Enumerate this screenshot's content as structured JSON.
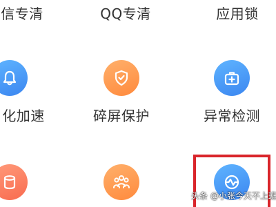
{
  "features": {
    "row1": [
      {
        "label": "信专清"
      },
      {
        "label": "QQ专清"
      },
      {
        "label": "应用锁"
      }
    ],
    "row2": [
      {
        "label": "化加速",
        "icon": "bell-icon"
      },
      {
        "label": "碎屏保护",
        "icon": "shield-check-icon"
      },
      {
        "label": "异常检测",
        "icon": "medical-kit-icon"
      }
    ],
    "row3": [
      {
        "icon": "cylinder-icon"
      },
      {
        "icon": "family-icon"
      },
      {
        "icon": "heartbeat-icon"
      }
    ]
  },
  "watermark": {
    "text": "头条 @小张今天不上班啦"
  },
  "colors": {
    "blue": "#3b86f0",
    "orange": "#ff8a3d",
    "coral": "#f96b4f",
    "highlight_border": "#d9252b",
    "label_text": "#333333"
  }
}
